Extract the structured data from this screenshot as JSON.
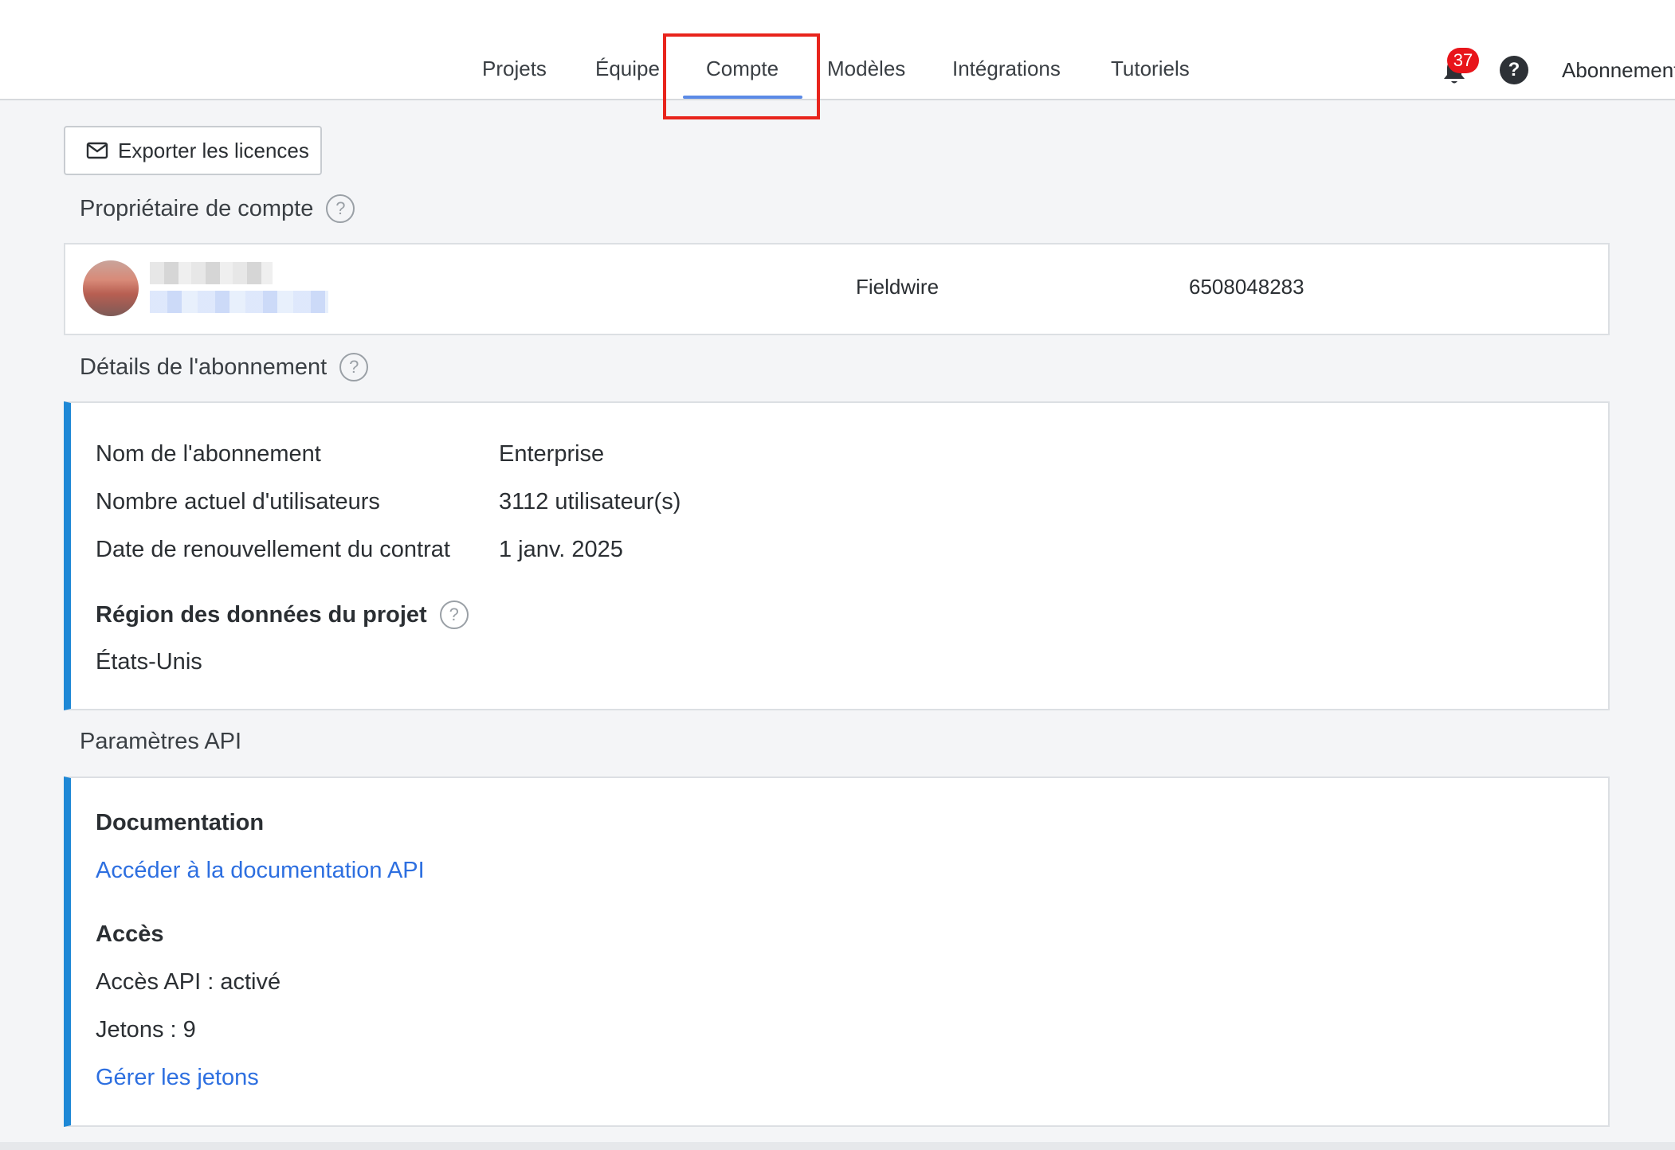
{
  "nav": {
    "items": [
      {
        "label": "Projets"
      },
      {
        "label": "Équipe"
      },
      {
        "label": "Compte"
      },
      {
        "label": "Modèles"
      },
      {
        "label": "Intégrations"
      },
      {
        "label": "Tutoriels"
      }
    ],
    "active": "Compte",
    "notifications_count": "37",
    "help_symbol": "?",
    "subscription_label": "Abonnement"
  },
  "toolbar": {
    "export_label": "Exporter les licences"
  },
  "owner": {
    "section_title": "Propriétaire de compte",
    "company": "Fieldwire",
    "phone": "6508048283"
  },
  "subscription": {
    "section_title": "Détails de l'abonnement",
    "rows": [
      {
        "label": "Nom de l'abonnement",
        "value": "Enterprise"
      },
      {
        "label": "Nombre actuel d'utilisateurs",
        "value": "3112 utilisateur(s)"
      },
      {
        "label": "Date de renouvellement du contrat",
        "value": "1 janv. 2025"
      }
    ],
    "region_heading": "Région des données du projet",
    "region_value": "États-Unis"
  },
  "api": {
    "section_title": "Paramètres API",
    "doc_heading": "Documentation",
    "doc_link": "Accéder à la documentation API",
    "access_heading": "Accès",
    "access_status": "Accès API : activé",
    "tokens": "Jetons : 9",
    "manage_link": "Gérer les jetons"
  },
  "colors": {
    "accent": "#1e88d6",
    "link": "#2d6fe0",
    "highlight": "#e8241c",
    "badge": "#e8151b",
    "tab_underline": "#5b8ae6"
  }
}
